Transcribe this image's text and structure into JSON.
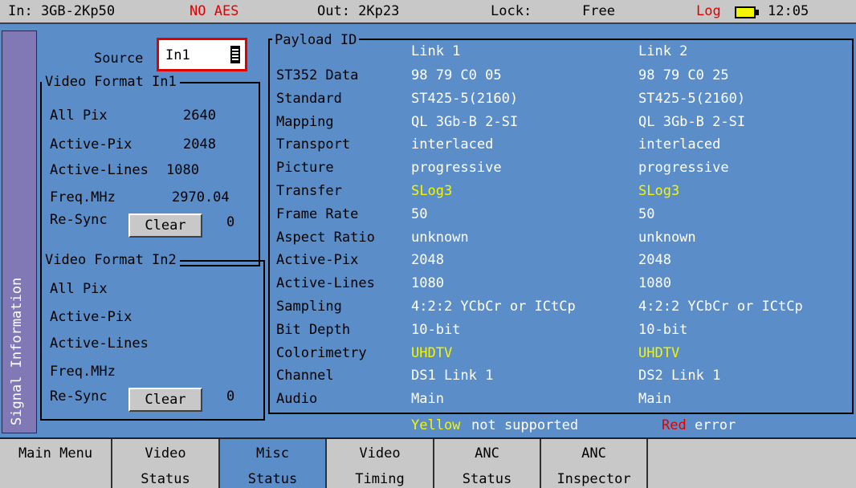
{
  "status_bar": {
    "input": "In: 3GB-2Kp50",
    "aes": "NO AES",
    "output": "Out: 2Kp23",
    "lock_label": "Lock:",
    "lock_value": "Free",
    "log": "Log",
    "time": "12:05",
    "battery_color": "#f5f500"
  },
  "side_tab": {
    "label": "Signal Information"
  },
  "source": {
    "label": "Source",
    "value": "In1"
  },
  "video_format_1": {
    "title": "Video Format In1",
    "rows": [
      {
        "label": "All Pix",
        "value": "2640"
      },
      {
        "label": "Active-Pix",
        "value": "2048"
      },
      {
        "label": "Active-Lines",
        "value": "1080"
      },
      {
        "label": "Freq.MHz",
        "value": "2970.04"
      }
    ],
    "resync_label": "Re-Sync",
    "clear_label": "Clear",
    "resync_count": "0"
  },
  "video_format_2": {
    "title": "Video Format In2",
    "rows": [
      {
        "label": "All Pix",
        "value": ""
      },
      {
        "label": "Active-Pix",
        "value": ""
      },
      {
        "label": "Active-Lines",
        "value": ""
      },
      {
        "label": "Freq.MHz",
        "value": ""
      }
    ],
    "resync_label": "Re-Sync",
    "clear_label": "Clear",
    "resync_count": "0"
  },
  "payload": {
    "title": "Payload ID",
    "headers": [
      "Link 1",
      "Link 2"
    ],
    "rows": [
      {
        "label": "ST352 Data",
        "link1": "98 79 C0 05",
        "link2": "98 79 C0 25"
      },
      {
        "label": "Standard",
        "link1": "ST425-5(2160)",
        "link2": "ST425-5(2160)"
      },
      {
        "label": "Mapping",
        "link1": "QL 3Gb-B 2-SI",
        "link2": "QL 3Gb-B 2-SI"
      },
      {
        "label": "Transport",
        "link1": "interlaced",
        "link2": "interlaced"
      },
      {
        "label": "Picture",
        "link1": "progressive",
        "link2": "progressive"
      },
      {
        "label": "Transfer",
        "link1": "SLog3",
        "link2": "SLog3"
      },
      {
        "label": "Frame Rate",
        "link1": "50",
        "link2": "50"
      },
      {
        "label": "Aspect Ratio",
        "link1": "unknown",
        "link2": "unknown"
      },
      {
        "label": "Active-Pix",
        "link1": "2048",
        "link2": "2048"
      },
      {
        "label": "Active-Lines",
        "link1": "1080",
        "link2": "1080"
      },
      {
        "label": "Sampling",
        "link1": "4:2:2 YCbCr or ICtCp",
        "link2": "4:2:2 YCbCr or ICtCp"
      },
      {
        "label": "Bit Depth",
        "link1": "10-bit",
        "link2": "10-bit"
      },
      {
        "label": "Colorimetry",
        "link1": "UHDTV",
        "link2": "UHDTV"
      },
      {
        "label": "Channel",
        "link1": "DS1 Link 1",
        "link2": "DS2 Link 1"
      },
      {
        "label": "Audio",
        "link1": "Main",
        "link2": "Main"
      }
    ],
    "legend": {
      "yellow_word": "Yellow",
      "yellow_text": "not supported",
      "red_word": "Red",
      "red_text": "error"
    }
  },
  "colors": {
    "background": "#5b8ec8",
    "unsupported": "#f5f500",
    "error": "#e00000",
    "side_tab": "#8178b6",
    "menu": "#c8c8c8"
  },
  "menu": [
    {
      "line1": "Main Menu",
      "line2": ""
    },
    {
      "line1": "Video",
      "line2": "Status"
    },
    {
      "line1": "Misc",
      "line2": "Status",
      "active": true
    },
    {
      "line1": "Video",
      "line2": "Timing"
    },
    {
      "line1": "ANC",
      "line2": "Status"
    },
    {
      "line1": "ANC",
      "line2": "Inspector"
    }
  ]
}
